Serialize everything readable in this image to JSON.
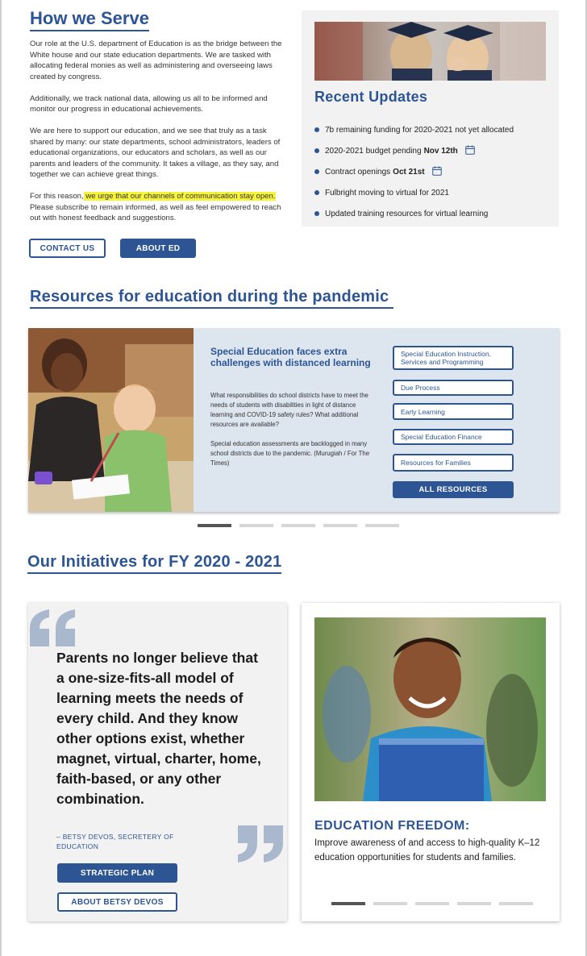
{
  "how_we_serve": {
    "title": "How we Serve",
    "p1": "Our role at the U.S. department of Education is as the bridge between the White house and our state education departments. We are tasked with allocating federal monies as well as administering and overseeing laws created by congress.",
    "p2": "Additionally, we track national data, allowing us all to be informed and monitor our progress in educational achievements.",
    "p3": "We are here to support our education, and we see that truly as a task shared by many: our state departments, school administrators, leaders of educational organizations, our educators and scholars, as well as our parents and leaders of the community. It takes a village, as they say, and together we can achieve great things.",
    "p4_pre": "For this reason,",
    "p4_highlight": " we urge that our channels of communication stay open.",
    "p4_post": " Please subscribe to remain informed, as well as feel empowered to reach out with honest feedback and suggestions.",
    "contact_label": "CONTACT US",
    "about_label": "ABOUT ED",
    "highlight_color": "#f6f43a"
  },
  "recent_updates": {
    "title": "Recent Updates",
    "items": [
      {
        "text": "7b remaining funding for 2020-2021 not yet allocated",
        "bold": "",
        "icon": ""
      },
      {
        "text": "2020-2021 budget pending",
        "bold": "Nov 12th",
        "icon": "calendar-icon"
      },
      {
        "text": "Contract openings",
        "bold": "Oct 21st",
        "icon": "calendar-icon"
      },
      {
        "text": "Fulbright moving to virtual for 2021",
        "bold": "",
        "icon": ""
      },
      {
        "text": "Updated training resources for virtual learning",
        "bold": "",
        "icon": ""
      }
    ]
  },
  "resources": {
    "title": "Resources for education during the pandemic",
    "card_heading": "Special Education faces extra challenges with distanced learning",
    "card_p1": "What responsibilities do school districts have to meet the needs of students with disabilities in light of distance learning and COVID-19 safety rules? What additional resources are available?",
    "card_p2": "Special education assessments are backlogged in many school districts due to the pandemic. (Murugiah / For The Times)",
    "links": [
      "Special Education Instruction, Services and Programming",
      "Due Process",
      "Early Learning",
      "Special Education Finance",
      "Resources for Families"
    ],
    "all_label": "ALL RESOURCES",
    "carousel_active": 1,
    "carousel_count": 5
  },
  "initiatives": {
    "title": "Our Initiatives for FY 2020 - 2021",
    "quote": "Parents no longer believe that a one-size-fits-all model of learning meets the needs of every child. And they know other options exist, whether magnet, virtual, charter, home, faith-based, or any other combination.",
    "attribution": "– BETSY DEVOS, SECRETERY OF EDUCATION",
    "strategic_label": "STRATEGIC PLAN",
    "about_devos_label": "ABOUT BETSY DEVOS",
    "freedom_title": "EDUCATION FREEDOM:",
    "freedom_text": "Improve awareness of and access to high-quality K–12 education opportunities for students and families.",
    "carousel_active": 1,
    "carousel_count": 5
  },
  "colors": {
    "brand_blue": "#2d5594",
    "panel_gray": "#f2f2f2",
    "card_blue": "#dde5ef"
  }
}
